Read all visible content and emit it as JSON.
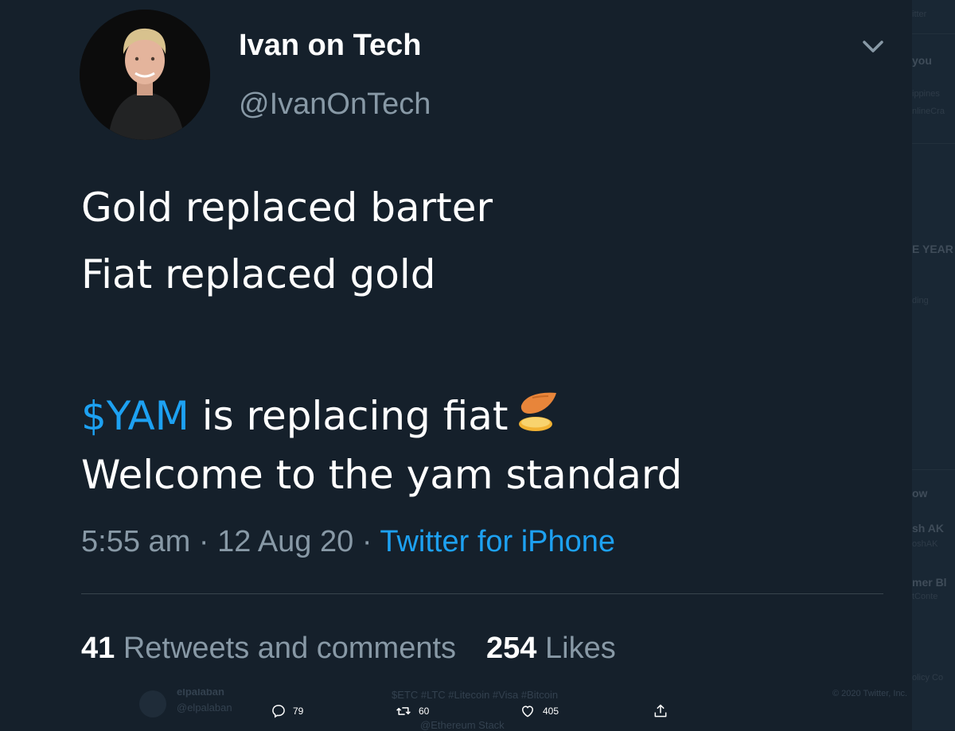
{
  "tweet": {
    "author_name": "Ivan on Tech",
    "author_handle": "@IvanOnTech",
    "lines": [
      "Gold replaced barter",
      "Fiat replaced gold"
    ],
    "cashtag": "$YAM",
    "line3_rest": " is replacing fiat",
    "line4": "Welcome to the yam standard",
    "time": "5:55 am",
    "sep1": " · ",
    "date": "12 Aug 20",
    "sep2": " · ",
    "source": "Twitter for iPhone",
    "retweets_count": "41",
    "retweets_label": " Retweets and comments",
    "likes_count": "254",
    "likes_label": " Likes",
    "icons": {
      "menu": "chevron-down-icon",
      "emoji": "yam-emoji"
    }
  },
  "background": {
    "sidebar_fragments": [
      "itter",
      "you",
      "ippines",
      "nlineCra",
      "E YEAR",
      "ding",
      "ow",
      "sh AK",
      "oshAK",
      "mer Bl",
      "tConte",
      "olicy  Co"
    ],
    "footer_copyright": "© 2020 Twitter, Inc.",
    "ghost_user_name": "elpalaban",
    "ghost_user_handle": "@elpalaban",
    "ghost_tags": "$ETC #LTC #Litecoin #Visa #Bitcoin",
    "ghost_link": "@Ethereum Stack",
    "action_bar": {
      "replies": "79",
      "retweets": "60",
      "likes": "405"
    }
  },
  "colors": {
    "background": "#15202b",
    "text": "#ffffff",
    "secondary": "#8899a6",
    "accent": "#1da1f2",
    "divider": "#38444d"
  }
}
